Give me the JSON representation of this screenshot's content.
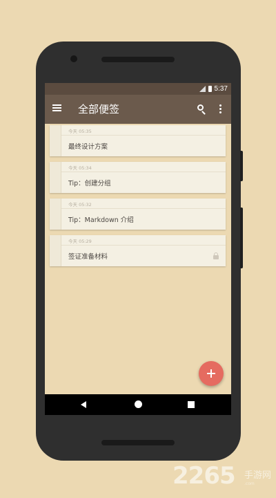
{
  "status_bar": {
    "time": "5:37"
  },
  "app_bar": {
    "title": "全部便签",
    "icons": [
      "menu-icon",
      "search-icon",
      "more-vert-icon"
    ]
  },
  "notes": [
    {
      "time": "今天 05:35",
      "title": "最终设计方案",
      "locked": false
    },
    {
      "time": "今天 05:34",
      "title": "Tip：创建分组",
      "locked": false
    },
    {
      "time": "今天 05:32",
      "title": "Tip：Markdown 介绍",
      "locked": false
    },
    {
      "time": "今天 05:29",
      "title": "签证准备材料",
      "locked": true
    }
  ],
  "fab": {
    "label": "+",
    "color": "#e56b60"
  },
  "colors": {
    "background": "#ecd9b2",
    "app_bar": "#6b5a4c",
    "status_bar": "#5b4b3f",
    "card": "#f4f0e3"
  },
  "watermark": {
    "number": "2265",
    "text": "手游网",
    "sub": ".com"
  }
}
